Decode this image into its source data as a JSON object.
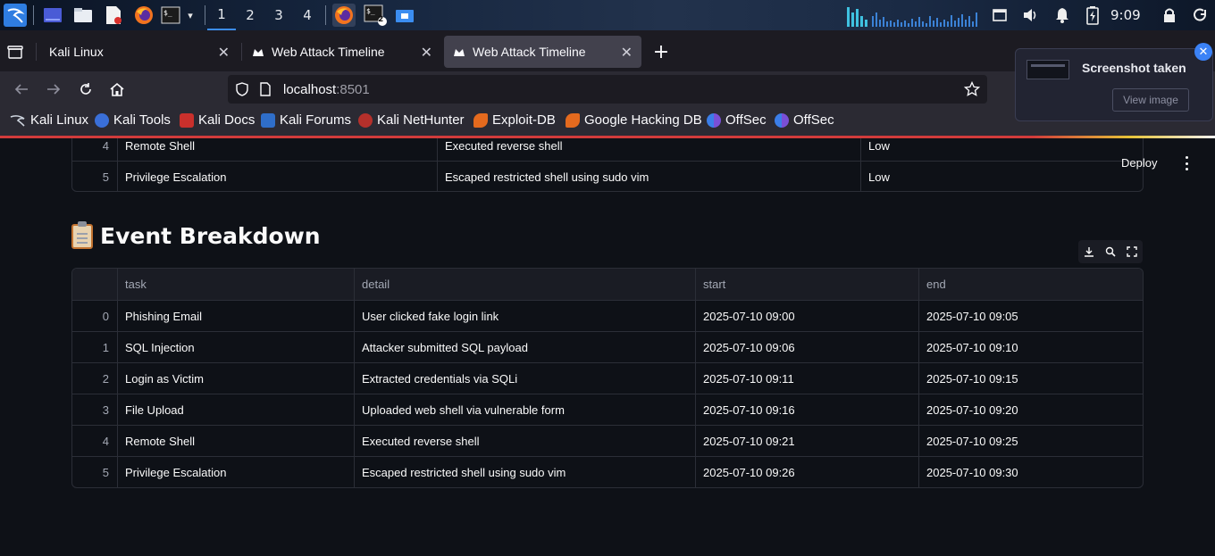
{
  "taskbar": {
    "workspaces": [
      "1",
      "2",
      "3",
      "4"
    ],
    "active_workspace": "1",
    "clock": "9:09",
    "icons": [
      "kali-menu-icon",
      "desktop-icon",
      "file-manager-icon",
      "text-editor-icon",
      "firefox-icon",
      "terminal-icon",
      "dropdown-icon"
    ],
    "task_icons": [
      "firefox-icon",
      "terminal-icon",
      "file-manager-icon"
    ],
    "terminal_badge": "2",
    "tray_icons": [
      "audio-visualizer-icon",
      "screen-icon",
      "volume-icon",
      "bell-icon",
      "battery-icon",
      "lock-icon",
      "power-icon"
    ]
  },
  "browser": {
    "tabs": [
      {
        "label": "Kali Linux",
        "active": false
      },
      {
        "label": "Web Attack Timeline",
        "active": false
      },
      {
        "label": "Web Attack Timeline",
        "active": true
      }
    ],
    "url_host": "localhost",
    "url_port": ":8501",
    "bookmarks": [
      "Kali Linux",
      "Kali Tools",
      "Kali Docs",
      "Kali Forums",
      "Kali NetHunter",
      "Exploit-DB",
      "Google Hacking DB",
      "OffSec",
      "OffSec"
    ]
  },
  "notification": {
    "title": "Screenshot taken",
    "button": "View image"
  },
  "app": {
    "deploy_label": "Deploy",
    "top_table": {
      "rows": [
        {
          "index": "4",
          "task": "Remote Shell",
          "detail": "Executed reverse shell",
          "severity": "Low"
        },
        {
          "index": "5",
          "task": "Privilege Escalation",
          "detail": "Escaped restricted shell using sudo vim",
          "severity": "Low"
        }
      ]
    },
    "section_title": "Event Breakdown",
    "breakdown": {
      "columns": [
        "task",
        "detail",
        "start",
        "end"
      ],
      "rows": [
        {
          "index": "0",
          "task": "Phishing Email",
          "detail": "User clicked fake login link",
          "start": "2025-07-10 09:00",
          "end": "2025-07-10 09:05"
        },
        {
          "index": "1",
          "task": "SQL Injection",
          "detail": "Attacker submitted SQL payload",
          "start": "2025-07-10 09:06",
          "end": "2025-07-10 09:10"
        },
        {
          "index": "2",
          "task": "Login as Victim",
          "detail": "Extracted credentials via SQLi",
          "start": "2025-07-10 09:11",
          "end": "2025-07-10 09:15"
        },
        {
          "index": "3",
          "task": "File Upload",
          "detail": "Uploaded web shell via vulnerable form",
          "start": "2025-07-10 09:16",
          "end": "2025-07-10 09:20"
        },
        {
          "index": "4",
          "task": "Remote Shell",
          "detail": "Executed reverse shell",
          "start": "2025-07-10 09:21",
          "end": "2025-07-10 09:25"
        },
        {
          "index": "5",
          "task": "Privilege Escalation",
          "detail": "Escaped restricted shell using sudo vim",
          "start": "2025-07-10 09:26",
          "end": "2025-07-10 09:30"
        }
      ]
    },
    "toolbar_icons": [
      "download-icon",
      "search-icon",
      "fullscreen-icon"
    ]
  }
}
